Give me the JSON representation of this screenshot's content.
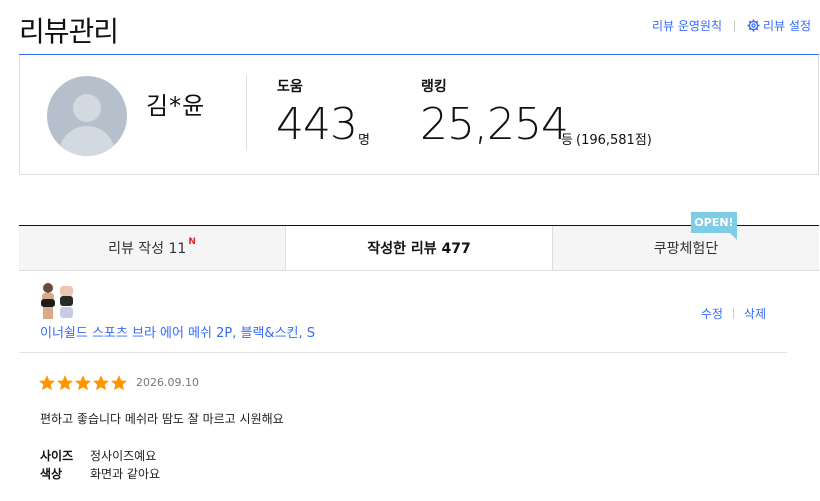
{
  "header": {
    "title": "리뷰관리",
    "policy_link": "리뷰 운영원칙",
    "settings_link": "리뷰 설정"
  },
  "profile": {
    "name": "김*윤",
    "help_label": "도움",
    "help_count": "443",
    "help_unit": "명",
    "rank_label": "랭킹",
    "rank_value": "25,254",
    "rank_unit": "등",
    "rank_total": "(196,581점)"
  },
  "tabs": [
    {
      "label": "리뷰 작성 11",
      "badge": "N"
    },
    {
      "label": "작성한 리뷰 477"
    },
    {
      "label": "쿠팡체험단",
      "badge": "OPEN!"
    }
  ],
  "review": {
    "product_name": "이너쉴드 스포츠 브라 에어 메쉬 2P, 블랙&스킨, S",
    "edit_label": "수정",
    "delete_label": "삭제",
    "rating": 5,
    "rating_max": 5,
    "date": "2026.09.10",
    "text": "편하고 좋습니다 메쉬라 땀도 잘 마르고 시원해요",
    "attributes": [
      {
        "key": "사이즈",
        "value": "정사이즈예요"
      },
      {
        "key": "색상",
        "value": "화면과 같아요"
      }
    ]
  },
  "colors": {
    "accent": "#346aff",
    "star": "#ff9600",
    "new_badge": "#e52528",
    "open_badge": "#7fcce6"
  }
}
